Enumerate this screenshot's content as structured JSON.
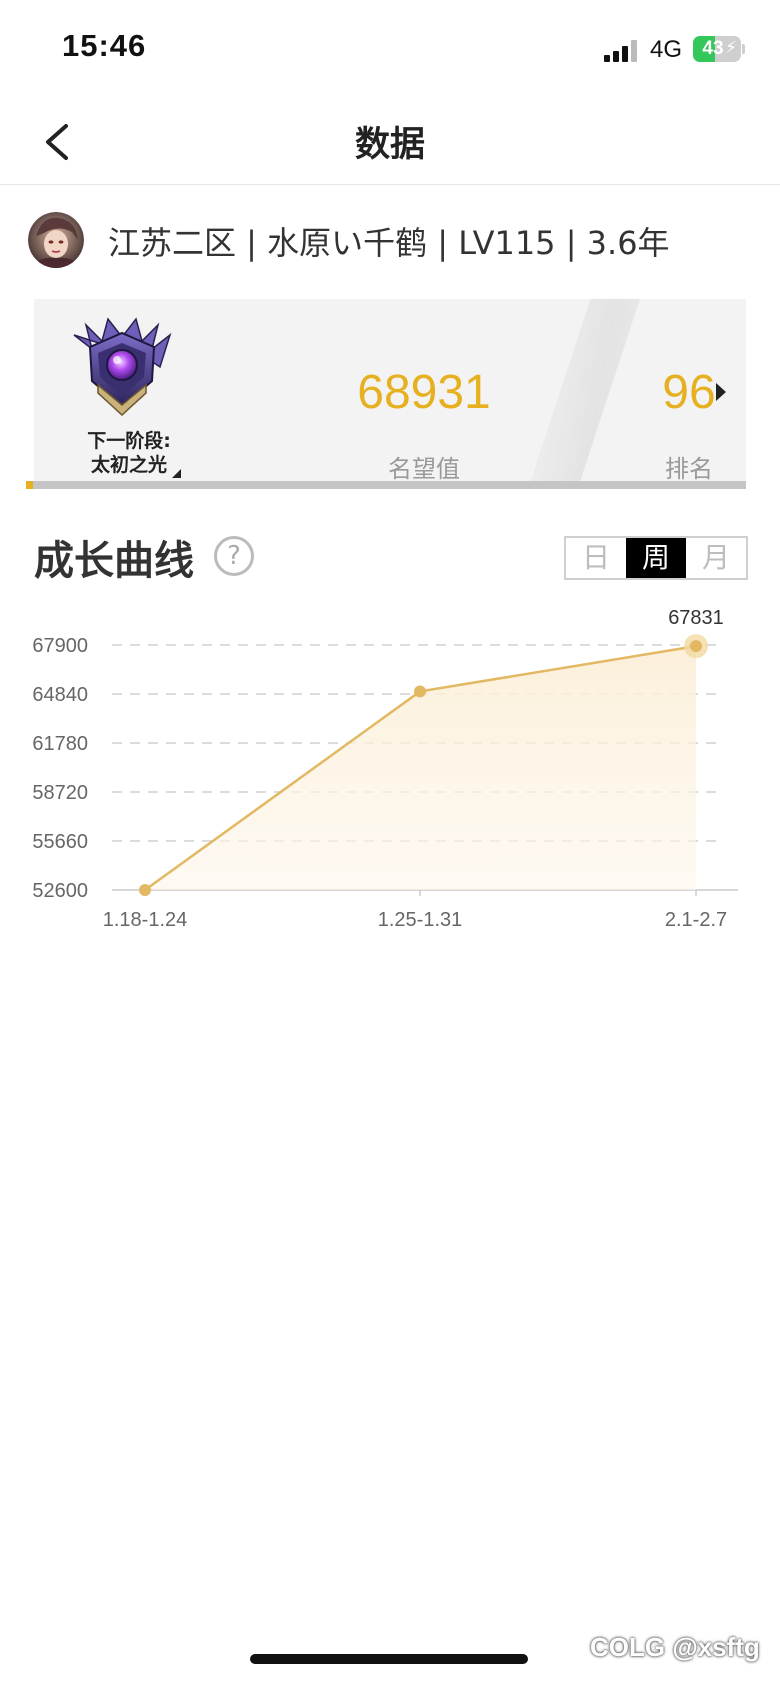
{
  "status": {
    "time": "15:46",
    "network": "4G",
    "battery": "43"
  },
  "nav": {
    "title": "数据"
  },
  "profile": {
    "text": "江苏二区 | 水原い千鹤 | LV115 | 3.6年"
  },
  "stats": {
    "next_stage_label": "下一阶段:",
    "next_stage_name": "太初之光",
    "fame_value": "68931",
    "fame_label": "名望值",
    "rank_value": "96",
    "rank_label": "排名",
    "accent_color": "#e6b020"
  },
  "growth": {
    "title": "成长曲线",
    "help_icon": "question-mark-icon",
    "periods": [
      "日",
      "周",
      "月"
    ],
    "active_period": "周"
  },
  "chart_data": {
    "type": "area",
    "title": "",
    "xlabel": "",
    "ylabel": "",
    "categories": [
      "1.18-1.24",
      "1.25-1.31",
      "2.1-2.7"
    ],
    "series": [
      {
        "values": [
          52600,
          65000,
          67831
        ]
      }
    ],
    "ylim": [
      52600,
      67900
    ],
    "yticks": [
      "67900",
      "64840",
      "61780",
      "58720",
      "55660",
      "52600"
    ],
    "highlight": {
      "index": 2,
      "label": "67831"
    },
    "grid": true,
    "line_color": "#e3b862"
  },
  "watermark": "COLG @xsftg"
}
